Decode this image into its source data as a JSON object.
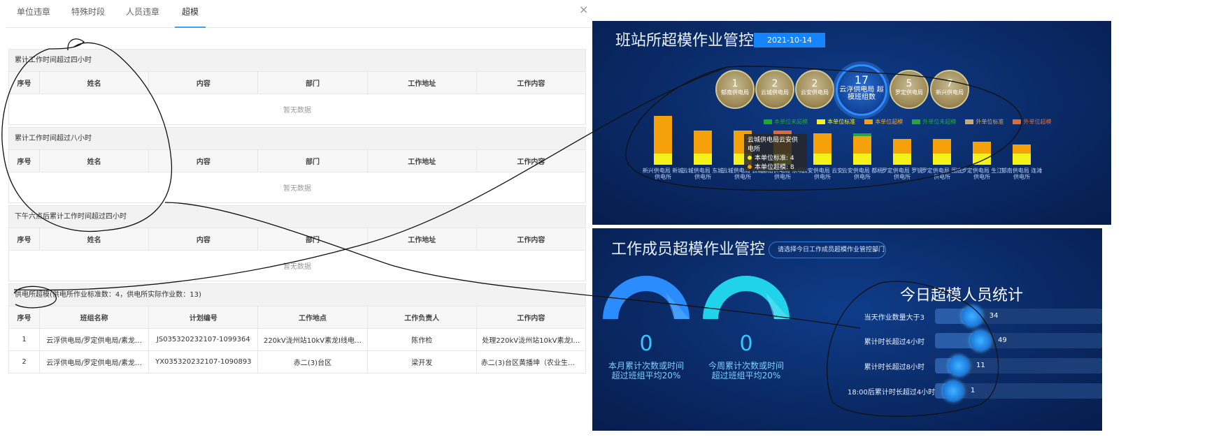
{
  "left": {
    "tabs": [
      "单位违章",
      "特殊时段",
      "人员违章",
      "超模"
    ],
    "close": "×",
    "sections": [
      {
        "title": "累计工作时间超过四小时",
        "headers": [
          "序号",
          "姓名",
          "内容",
          "部门",
          "工作地址",
          "工作内容"
        ],
        "empty": "暂无数据"
      },
      {
        "title": "累计工作时间超过八小时",
        "headers": [
          "序号",
          "姓名",
          "内容",
          "部门",
          "工作地址",
          "工作内容"
        ],
        "empty": "暂无数据"
      },
      {
        "title": "下午六点后累计工作时间超过四小时",
        "headers": [
          "序号",
          "姓名",
          "内容",
          "部门",
          "工作地址",
          "工作内容"
        ],
        "empty": "暂无数据"
      },
      {
        "title": "供电所超模(供电所作业标准数：4，供电所实际作业数：13)",
        "headers": [
          "序号",
          "班组名称",
          "计划编号",
          "工作地点",
          "工作负责人",
          "工作内容"
        ],
        "rows": [
          [
            "1",
            "云浮供电局/罗定供电局/素龙…",
            "JS035320232107-1099364",
            "220kV泷州站10kV素龙Ⅰ线电…",
            "陈作检",
            "处理220kV泷州站10kV素龙Ⅰ…"
          ],
          [
            "2",
            "云浮供电局/罗定供电局/素龙…",
            "YX035320232107-1090893",
            "赤二(3)台区",
            "梁开发",
            "赤二(3)台区黄播坤（农业生产…"
          ]
        ]
      }
    ]
  },
  "top_panel": {
    "title": "班站所超模作业管控",
    "date": "2021-10-14",
    "bubbles": [
      {
        "num": "1",
        "label": "郁南供电局"
      },
      {
        "num": "2",
        "label": "云城供电局"
      },
      {
        "num": "2",
        "label": "云安供电局"
      },
      {
        "num": "17",
        "label": "云浮供电局 超模班组数"
      },
      {
        "num": "5",
        "label": "罗定供电局"
      },
      {
        "num": "7",
        "label": "新兴供电局"
      }
    ],
    "legend": [
      {
        "label": "本单位未超模",
        "color": "#22a52e"
      },
      {
        "label": "本单位标准",
        "color": "#f5f21a"
      },
      {
        "label": "本单位超模",
        "color": "#f5a20a"
      },
      {
        "label": "外单位未超模",
        "color": "#27a53a"
      },
      {
        "label": "外单位标准",
        "color": "#c9a97a"
      },
      {
        "label": "外单位超模",
        "color": "#e06b3a"
      }
    ],
    "tooltip": {
      "title": "云城供电局云安供电所",
      "line1": "本单位标准: 4",
      "line2": "本单位超模: 8"
    },
    "chevron": "»"
  },
  "chart_data": {
    "type": "bar",
    "categories": [
      "新兴供电局 新城供电所",
      "云城供电局 东城供电所",
      "云城供电局 云城供电所",
      "郁南供电局 东坝供电所",
      "云安供电局 云安供电所",
      "云安供电局 都杨供电所",
      "罗定供电局 罗镜供电所",
      "罗定供电局 围底供电所",
      "罗定供电局 生江供电所",
      "郁南供电局 连滩供电所"
    ],
    "series": [
      {
        "name": "本单位标准",
        "values": [
          4,
          4,
          4,
          4,
          4,
          4,
          4,
          4,
          4,
          4
        ]
      },
      {
        "name": "本单位超模",
        "values": [
          13,
          8,
          8,
          6,
          7,
          6,
          5,
          5,
          4,
          3
        ]
      },
      {
        "name": "外单位超模",
        "values": [
          0,
          0,
          0,
          2,
          0,
          0,
          0,
          0,
          0,
          0
        ]
      },
      {
        "name": "外单位未超模",
        "values": [
          0,
          0,
          0,
          0,
          0,
          1,
          0,
          0,
          0,
          0
        ]
      }
    ],
    "ylim": [
      0,
      18
    ]
  },
  "bottom_panel": {
    "title": "工作成员超模作业管控",
    "select_placeholder": "请选择今日工作成员超模作业管控部门",
    "select_arrow": "⌄",
    "gauges": [
      {
        "value": "0",
        "caption1": "本月累计次数或时间",
        "caption2": "超过班组平均20%"
      },
      {
        "value": "0",
        "caption1": "今周累计次数或时间",
        "caption2": "超过班组平均20%"
      }
    ],
    "stats_title": "今日超模人员统计",
    "stats": [
      {
        "label": "当天作业数量大于3",
        "value": 34
      },
      {
        "label": "累计时长超过4小时",
        "value": 49
      },
      {
        "label": "累计时长超过8小时",
        "value": 11
      },
      {
        "label": "18:00后累计时长超过4小时",
        "value": 1
      }
    ]
  }
}
